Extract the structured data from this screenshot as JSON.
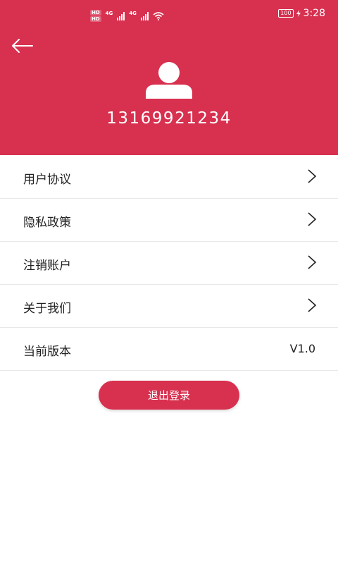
{
  "statusbar": {
    "hd1": "HD",
    "hd2": "HD",
    "net1": "4G",
    "net2": "4G",
    "battery": "100",
    "time": "3:28"
  },
  "profile": {
    "phone": "13169921234"
  },
  "menu": {
    "items": [
      {
        "label": "用户协议"
      },
      {
        "label": "隐私政策"
      },
      {
        "label": "注销账户"
      },
      {
        "label": "关于我们"
      }
    ],
    "version_label": "当前版本",
    "version_value": "V1.0"
  },
  "logout_label": "退出登录",
  "colors": {
    "accent": "#d8304f"
  }
}
